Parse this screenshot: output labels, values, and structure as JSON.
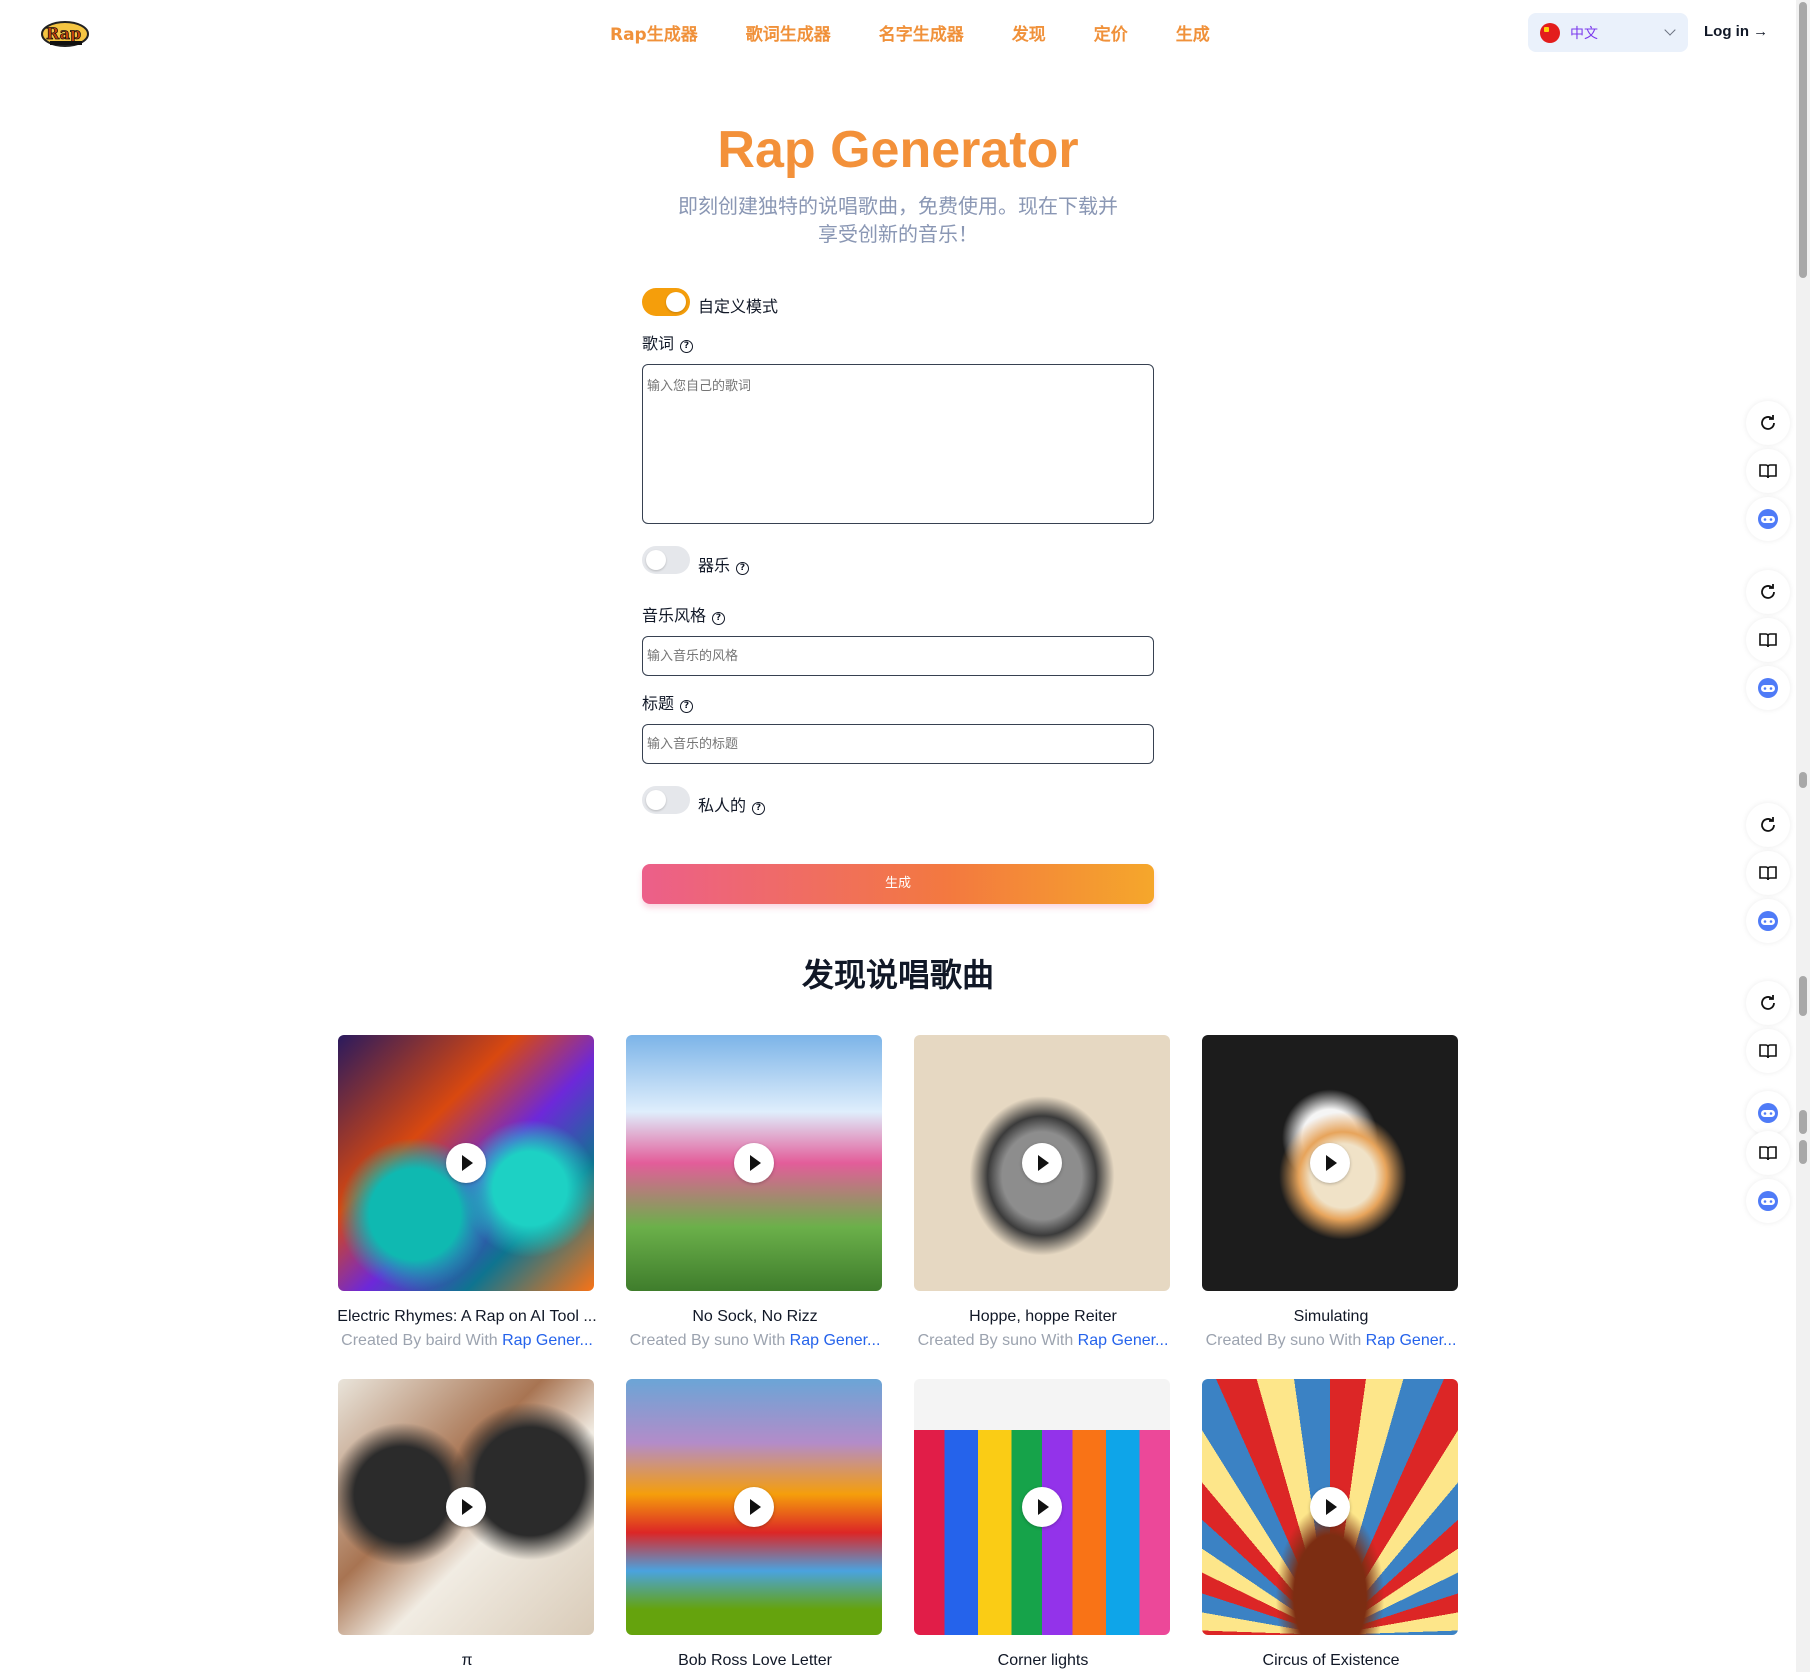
{
  "header": {
    "logo_text": "Rap Generator",
    "nav": [
      "Rap生成器",
      "歌词生成器",
      "名字生成器",
      "发现",
      "定价",
      "生成"
    ],
    "language": "中文",
    "login": "Log in →"
  },
  "hero": {
    "title": "Rap Generator",
    "subtitle": "即刻创建独特的说唱歌曲，免费使用。现在下载并享受创新的音乐！"
  },
  "form": {
    "custom_mode_label": "自定义模式",
    "custom_mode_on": true,
    "lyrics_label": "歌词",
    "lyrics_placeholder": "输入您自己的歌词",
    "instrumental_label": "器乐",
    "instrumental_on": false,
    "style_label": "音乐风格",
    "style_placeholder": "输入音乐的风格",
    "title_label": "标题",
    "title_placeholder": "输入音乐的标题",
    "private_label": "私人的",
    "private_on": false,
    "generate_label": "生成"
  },
  "discover": {
    "title": "发现说唱歌曲",
    "songs": [
      {
        "title": "Electric Rhymes: A Rap on AI Tool ...",
        "by": "Created By baird With ",
        "link": "Rap Gener..."
      },
      {
        "title": "No Sock, No Rizz",
        "by": "Created By suno With ",
        "link": "Rap Gener..."
      },
      {
        "title": "Hoppe, hoppe Reiter",
        "by": "Created By suno With ",
        "link": "Rap Gener..."
      },
      {
        "title": "Simulating",
        "by": "Created By suno With ",
        "link": "Rap Gener..."
      },
      {
        "title": "π",
        "by": "",
        "link": ""
      },
      {
        "title": "Bob Ross Love Letter",
        "by": "",
        "link": ""
      },
      {
        "title": "Corner lights",
        "by": "",
        "link": ""
      },
      {
        "title": "Circus of Existence",
        "by": "",
        "link": ""
      }
    ]
  },
  "colors": {
    "accent": "#f3913a",
    "toggle_on": "#f59e0b",
    "link": "#2563eb"
  },
  "rail_icons": [
    "refresh-icon",
    "book-icon",
    "robot-icon"
  ]
}
